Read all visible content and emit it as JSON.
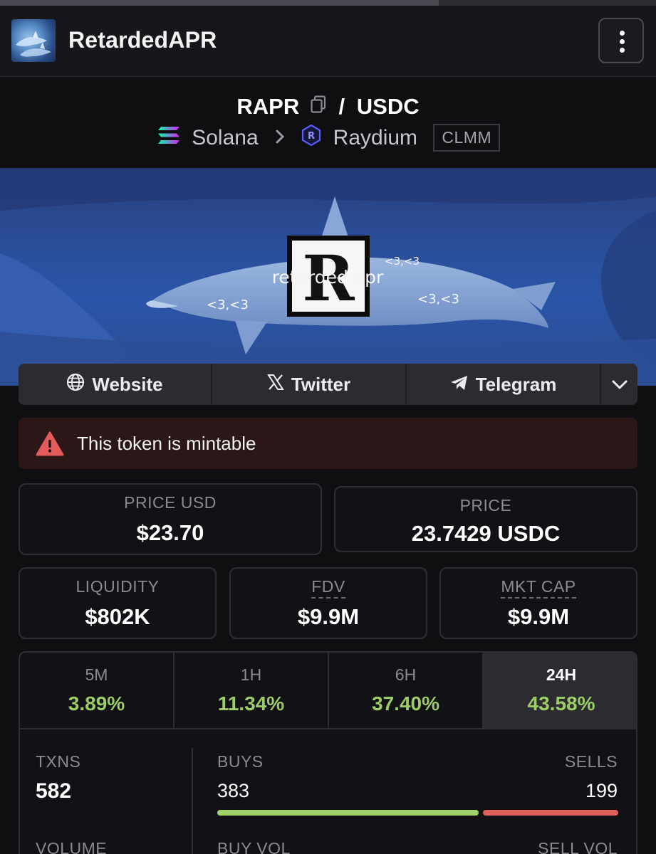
{
  "app": {
    "title": "RetardedAPR"
  },
  "pair": {
    "base": "RAPR",
    "separator": "/",
    "quote": "USDC",
    "chain": "Solana",
    "dex": "Raydium",
    "pool_type": "CLMM"
  },
  "banner": {
    "center_letter": "R",
    "caption": "retarded apr",
    "hearts": [
      "<3,<3",
      "<3,<3",
      "<3,<3"
    ]
  },
  "links": [
    {
      "label": "Website",
      "icon": "globe-icon"
    },
    {
      "label": "Twitter",
      "icon": "x-logo-icon"
    },
    {
      "label": "Telegram",
      "icon": "telegram-icon"
    }
  ],
  "warning": {
    "text": "This token is mintable",
    "color": "#e35b5b"
  },
  "stats": {
    "price_usd": {
      "label": "PRICE USD",
      "value": "$23.70"
    },
    "price": {
      "label": "PRICE",
      "value": "23.7429 USDC"
    },
    "liquidity": {
      "label": "LIQUIDITY",
      "value": "$802K"
    },
    "fdv": {
      "label": "FDV",
      "value": "$9.9M"
    },
    "mkt_cap": {
      "label": "MKT CAP",
      "value": "$9.9M"
    }
  },
  "timeframes": [
    {
      "label": "5M",
      "change": "3.89%"
    },
    {
      "label": "1H",
      "change": "11.34%"
    },
    {
      "label": "6H",
      "change": "37.40%"
    },
    {
      "label": "24H",
      "change": "43.58%",
      "active": true
    }
  ],
  "txns": {
    "label": "TXNS",
    "total": "582",
    "buys_label": "BUYS",
    "buys": "383",
    "sells_label": "SELLS",
    "sells": "199",
    "buy_fraction": 0.658
  },
  "volume": {
    "label": "VOLUME",
    "buy_label": "BUY VOL",
    "sell_label": "SELL VOL"
  },
  "colors": {
    "positive": "#9ccc65",
    "negative": "#e35b5b",
    "buy_bar": "#a3d16d",
    "sell_bar": "#e0615a"
  }
}
